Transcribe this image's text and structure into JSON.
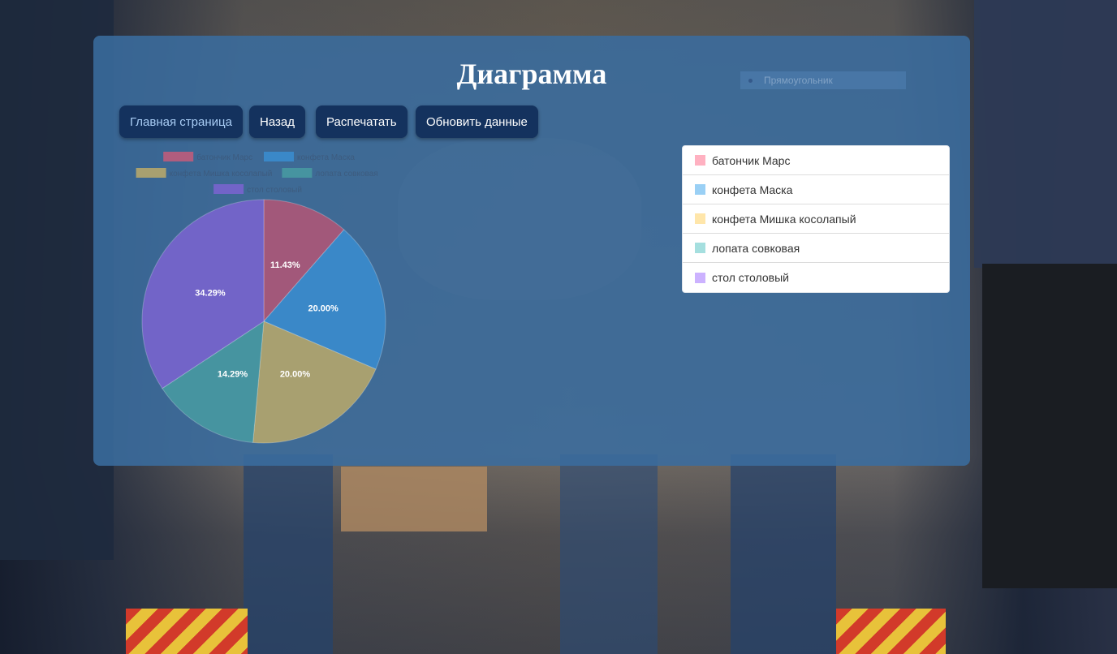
{
  "page": {
    "title": "Диаграмма",
    "shape_select": {
      "selected": "Прямоугольник"
    }
  },
  "toolbar": {
    "buttons": [
      {
        "label": "Главная страница"
      },
      {
        "label": "Назад"
      },
      {
        "label": "Распечатать"
      },
      {
        "label": "Обновить данные"
      }
    ]
  },
  "legend_list": {
    "items": [
      {
        "label": "батончик Марс",
        "color": "#ffb1c1"
      },
      {
        "label": "конфета Маска",
        "color": "#9ad0f5"
      },
      {
        "label": "конфета Мишка косолапый",
        "color": "#ffe6aa"
      },
      {
        "label": "лопата совковая",
        "color": "#a5dfdf"
      },
      {
        "label": "стол столовый",
        "color": "#ccb2ff"
      }
    ]
  },
  "chart_data": {
    "type": "pie",
    "title": "",
    "categories": [
      "батончик Марс",
      "конфета Маска",
      "конфета Мишка косолапый",
      "лопата совковая",
      "стол столовый"
    ],
    "values": [
      11.43,
      20.0,
      20.0,
      14.29,
      34.29
    ],
    "data_labels": [
      "11.43%",
      "20.00%",
      "20.00%",
      "14.29%",
      "34.29%"
    ],
    "colors": [
      "#a2587a",
      "#3a88c8",
      "#a8a070",
      "#4694a0",
      "#7264c8"
    ],
    "legend_colors": [
      "#b05d7e",
      "#3a88c8",
      "#a8a070",
      "#4694a0",
      "#7264c8"
    ],
    "legend_placement": "top"
  }
}
